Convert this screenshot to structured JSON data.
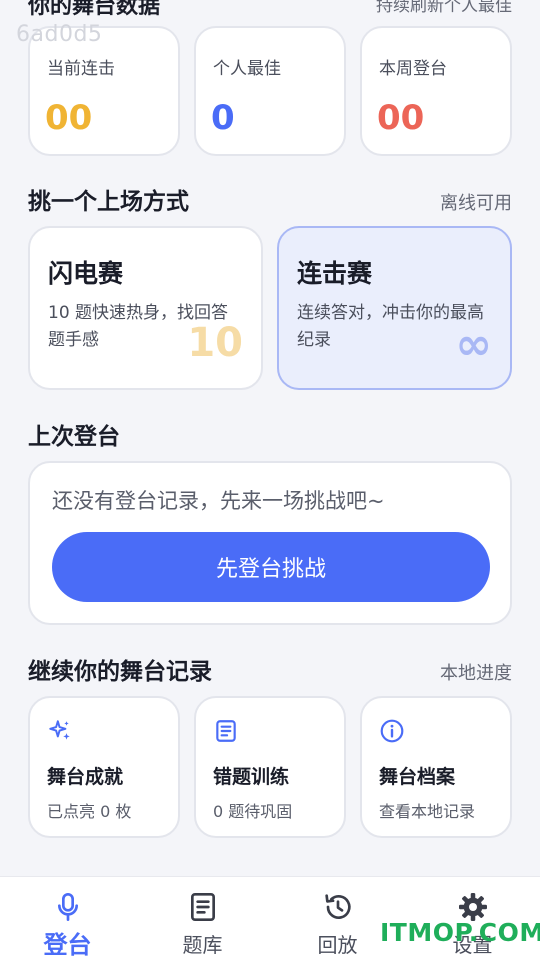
{
  "stats_section": {
    "title": "你的舞台数据",
    "aside": "持续刷新个人最佳",
    "watermark": "6ad0d5",
    "cards": [
      {
        "label": "当前连击",
        "value": "00",
        "color": "#f0b434"
      },
      {
        "label": "个人最佳",
        "value": "0",
        "color": "#4a6cf7"
      },
      {
        "label": "本周登台",
        "value": "00",
        "color": "#ec6557"
      }
    ]
  },
  "mode_section": {
    "title": "挑一个上场方式",
    "aside": "离线可用",
    "modes": [
      {
        "title": "闪电赛",
        "desc": "10 题快速热身，找回答题手感",
        "big": "10",
        "big_color": "#f6dca6"
      },
      {
        "title": "连击赛",
        "desc": "连续答对，冲击你的最高纪录",
        "big": "∞",
        "big_color": "#a9b8f5"
      }
    ]
  },
  "last_section": {
    "title": "上次登台",
    "empty_text": "还没有登台记录，先来一场挑战吧~",
    "button_label": "先登台挑战"
  },
  "records_section": {
    "title": "继续你的舞台记录",
    "aside": "本地进度",
    "items": [
      {
        "title": "舞台成就",
        "sub": "已点亮 0 枚",
        "icon": "sparkle-icon"
      },
      {
        "title": "错题训练",
        "sub": "0 题待巩固",
        "icon": "notebook-icon"
      },
      {
        "title": "舞台档案",
        "sub": "查看本地记录",
        "icon": "info-icon"
      }
    ]
  },
  "nav": {
    "items": [
      {
        "label": "登台",
        "icon": "microphone-icon",
        "active": true
      },
      {
        "label": "题库",
        "icon": "question-bank-icon",
        "active": false
      },
      {
        "label": "回放",
        "icon": "replay-icon",
        "active": false
      },
      {
        "label": "设置",
        "icon": "gear-icon",
        "active": false
      }
    ]
  },
  "overlay_watermark": "ITMOP.COM",
  "colors": {
    "accent": "#4a6cf7",
    "background": "#f4f5f9",
    "brand_watermark": "#1fae5a"
  }
}
